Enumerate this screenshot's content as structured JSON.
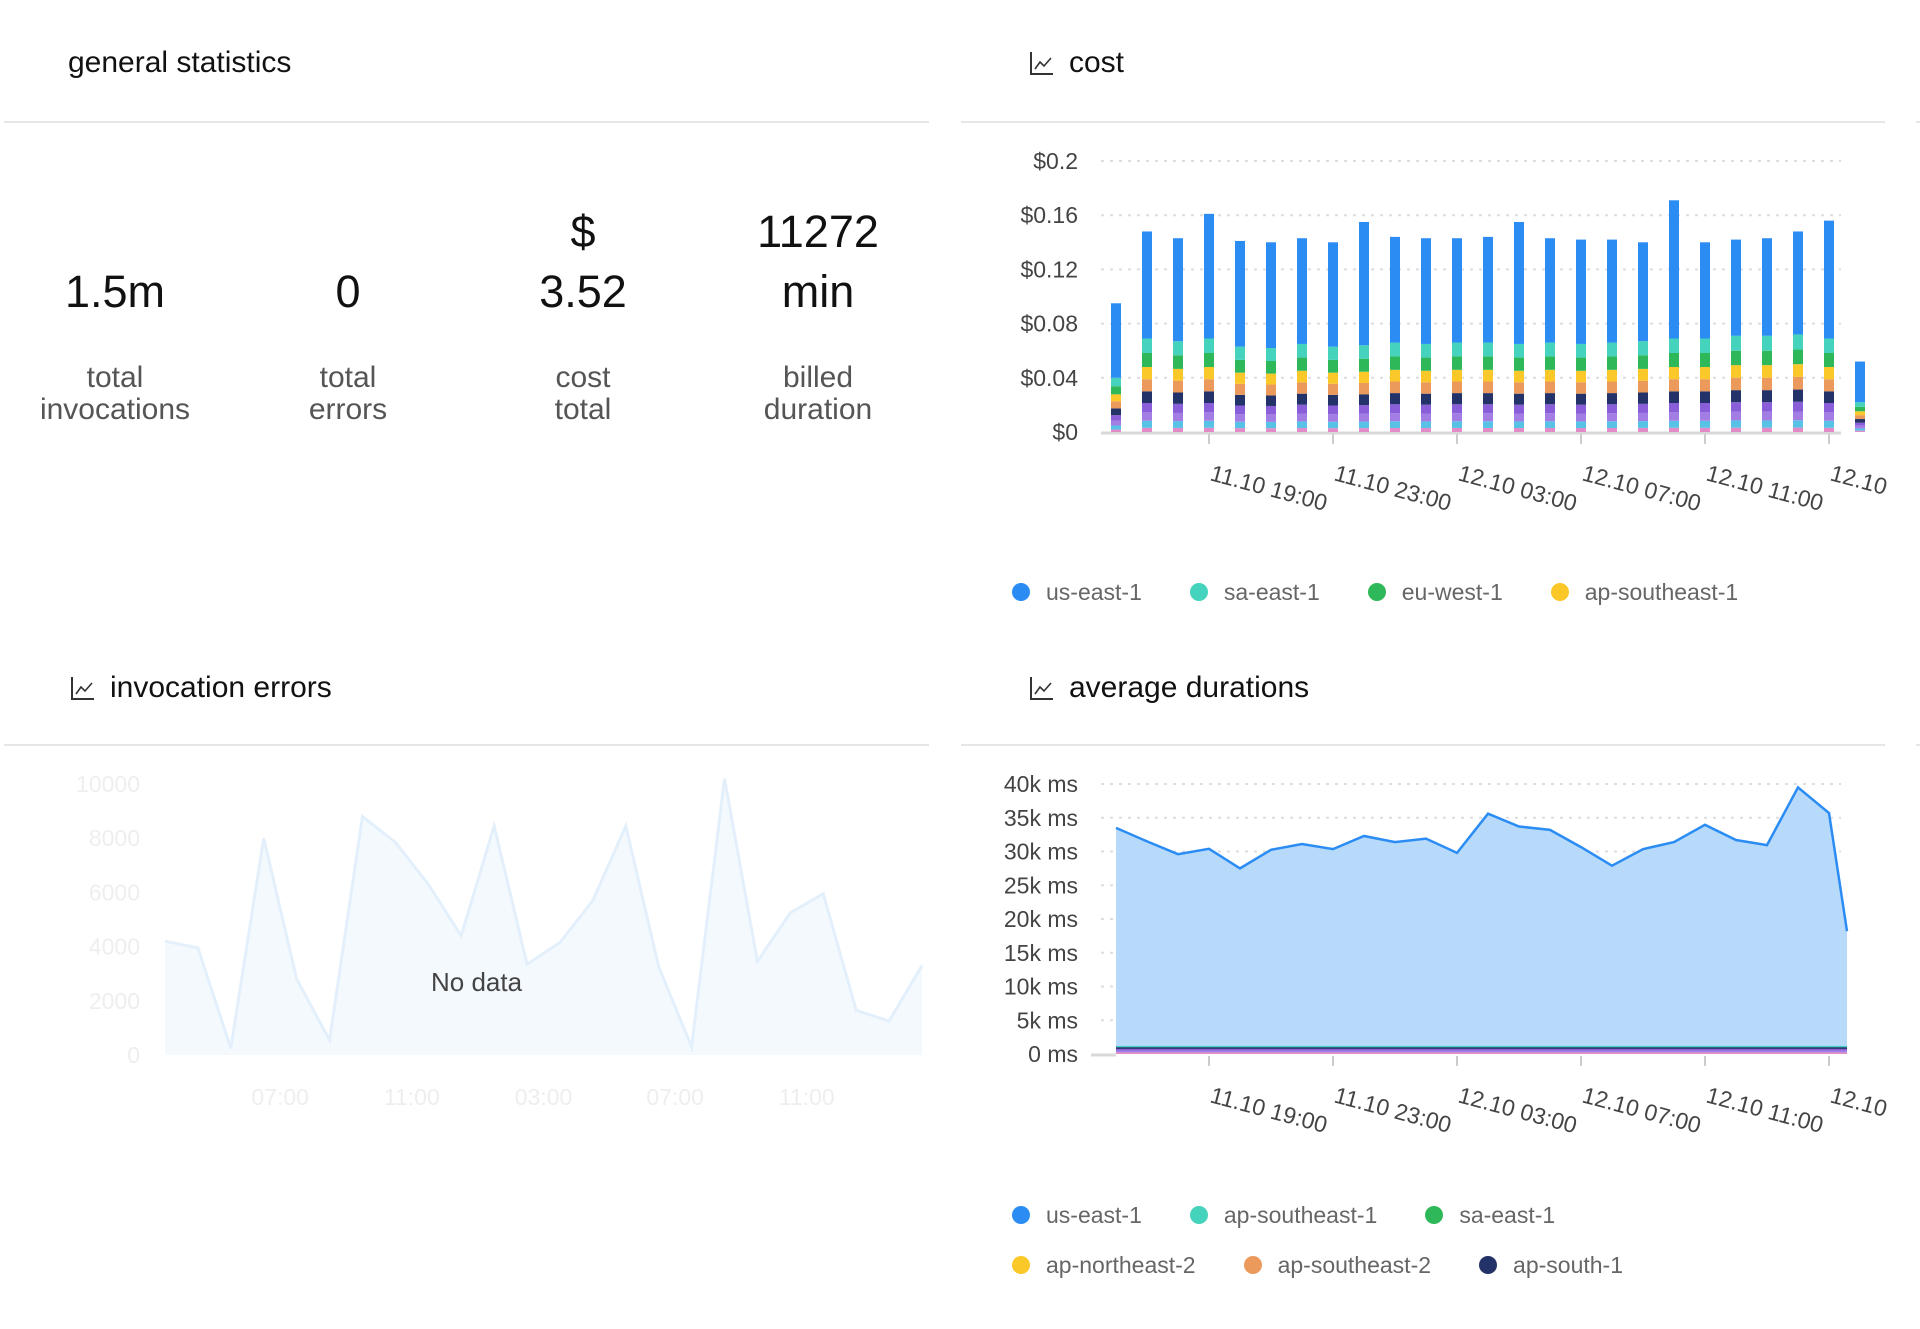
{
  "general_statistics": {
    "title": "general statistics",
    "stats": [
      {
        "value_lines": [
          "1.5m"
        ],
        "label_lines": [
          "total",
          "invocations"
        ]
      },
      {
        "value_lines": [
          "0"
        ],
        "label_lines": [
          "total",
          "errors"
        ]
      },
      {
        "value_lines": [
          "$",
          "3.52"
        ],
        "label_lines": [
          "cost",
          "total"
        ]
      },
      {
        "value_lines": [
          "11272",
          "min"
        ],
        "label_lines": [
          "billed",
          "duration"
        ]
      }
    ]
  },
  "panels": {
    "cost": {
      "title": "cost",
      "icon": "line-chart-icon"
    },
    "invocation_errors": {
      "title": "invocation errors",
      "icon": "line-chart-icon",
      "empty_message": "No data"
    },
    "average_durations": {
      "title": "average durations",
      "icon": "line-chart-icon"
    }
  },
  "colors": {
    "us-east-1": "#2b8cf4",
    "teal": "#45d3bd",
    "green": "#2fb85a",
    "yellow": "#fbc82a",
    "orange": "#ec9a5c",
    "navy": "#233268",
    "purple": "#8a5ed8",
    "violet": "#a27ee4",
    "cyan": "#58c2e6",
    "pink": "#e38bc7",
    "area_fill": "#b7dafb",
    "grid": "#dddddd",
    "ghost_line": "#e3f0fb",
    "ghost_fill": "#f4f9fe",
    "ghost_text": "#eeeeee"
  },
  "chart_data": [
    {
      "id": "cost",
      "type": "bar",
      "stacked": true,
      "title": "cost",
      "ylim": [
        0,
        0.2
      ],
      "yticks": [
        0,
        0.04,
        0.08,
        0.12,
        0.16,
        0.2
      ],
      "ytick_labels": [
        "$0",
        "$0.04",
        "$0.08",
        "$0.12",
        "$0.16",
        "$0.2"
      ],
      "grid": true,
      "xtick_labels": [
        "11.10 19:00",
        "11.10 23:00",
        "12.10 03:00",
        "12.10 07:00",
        "12.10 11:00",
        "12.10"
      ],
      "xtick_bar_index": [
        3,
        7,
        11,
        15,
        19,
        23
      ],
      "bar_count": 25,
      "totals": [
        0.095,
        0.148,
        0.143,
        0.161,
        0.141,
        0.14,
        0.143,
        0.14,
        0.155,
        0.144,
        0.143,
        0.143,
        0.144,
        0.155,
        0.143,
        0.142,
        0.142,
        0.14,
        0.171,
        0.14,
        0.142,
        0.143,
        0.148,
        0.156,
        0.052
      ],
      "segment_order_bottom_to_top": [
        "pink",
        "cyan",
        "violet",
        "purple",
        "navy",
        "orange",
        "yellow",
        "green",
        "teal",
        "us-east-1"
      ],
      "segment_shares_of_non_blue": [
        0.045,
        0.075,
        0.09,
        0.1,
        0.125,
        0.13,
        0.13,
        0.15,
        0.155
      ],
      "non_blue_totals": [
        0.04,
        0.069,
        0.067,
        0.069,
        0.063,
        0.062,
        0.065,
        0.063,
        0.064,
        0.066,
        0.065,
        0.066,
        0.066,
        0.065,
        0.066,
        0.065,
        0.066,
        0.067,
        0.069,
        0.069,
        0.071,
        0.071,
        0.072,
        0.069,
        0.022
      ],
      "legend": [
        {
          "name": "us-east-1",
          "color": "#2b8cf4"
        },
        {
          "name": "sa-east-1",
          "color": "#45d3bd"
        },
        {
          "name": "eu-west-1",
          "color": "#2fb85a"
        },
        {
          "name": "ap-southeast-1",
          "color": "#fbc82a"
        }
      ],
      "legend_position": "bottom"
    },
    {
      "id": "invocation_errors",
      "type": "area",
      "title": "invocation errors",
      "placeholder": true,
      "ylim": [
        0,
        10000
      ],
      "yticks": [
        0,
        2000,
        4000,
        6000,
        8000,
        10000
      ],
      "ytick_labels": [
        "0",
        "2000",
        "4000",
        "6000",
        "8000",
        "10000"
      ],
      "xtick_labels": [
        "07:00",
        "11:00",
        "03:00",
        "07:00",
        "11:00"
      ],
      "xtick_point_index": [
        3.5,
        7.5,
        11.5,
        15.5,
        19.5
      ],
      "values": [
        4200,
        3950,
        250,
        8000,
        2800,
        550,
        8800,
        7850,
        6300,
        4400,
        8450,
        3350,
        4150,
        5700,
        8450,
        3250,
        300,
        10200,
        3450,
        5250,
        5950,
        1650,
        1250,
        3300
      ],
      "overlay_text": "No data"
    },
    {
      "id": "average_durations",
      "type": "area",
      "title": "average durations",
      "ylim": [
        0,
        40000
      ],
      "yticks": [
        0,
        5000,
        10000,
        15000,
        20000,
        25000,
        30000,
        35000,
        40000
      ],
      "ytick_labels": [
        "0 ms",
        "5k ms",
        "10k ms",
        "15k ms",
        "20k ms",
        "25k ms",
        "30k ms",
        "35k ms",
        "40k ms"
      ],
      "grid": true,
      "xtick_labels": [
        "11.10 19:00",
        "11.10 23:00",
        "12.10 03:00",
        "12.10 07:00",
        "12.10 11:00",
        "12.10"
      ],
      "xtick_point_index": [
        3,
        7,
        11,
        15,
        19,
        23
      ],
      "series": [
        {
          "name": "us-east-1",
          "color": "#2b8cf4",
          "values": [
            33500,
            31500,
            29600,
            30400,
            27500,
            30250,
            31100,
            30350,
            32300,
            31400,
            31900,
            29800,
            35600,
            33700,
            33200,
            30650,
            27900,
            30350,
            31400,
            33950,
            31700,
            30950,
            39500,
            35700,
            18200
          ]
        },
        {
          "name": "ap-southeast-1",
          "color": "#45d3bd",
          "approx_value": 1100
        },
        {
          "name": "sa-east-1",
          "color": "#2fb85a",
          "approx_value": 1050
        },
        {
          "name": "ap-northeast-2",
          "color": "#fbc82a",
          "approx_value": 1000
        },
        {
          "name": "ap-southeast-2",
          "color": "#ec9a5c",
          "approx_value": 950
        },
        {
          "name": "ap-south-1",
          "color": "#233268",
          "approx_value": 900
        }
      ],
      "legend": [
        {
          "name": "us-east-1",
          "color": "#2b8cf4"
        },
        {
          "name": "ap-southeast-1",
          "color": "#45d3bd"
        },
        {
          "name": "sa-east-1",
          "color": "#2fb85a"
        },
        {
          "name": "ap-northeast-2",
          "color": "#fbc82a"
        },
        {
          "name": "ap-southeast-2",
          "color": "#ec9a5c"
        },
        {
          "name": "ap-south-1",
          "color": "#233268"
        }
      ],
      "legend_position": "bottom"
    }
  ]
}
